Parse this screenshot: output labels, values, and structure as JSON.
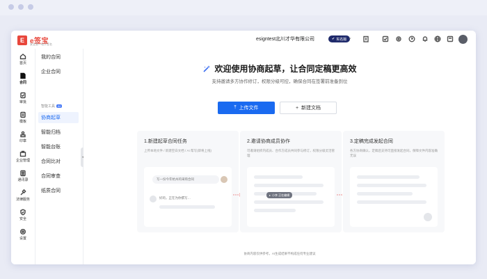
{
  "app": {
    "logo_text": "e签宝",
    "logo_subtitle": "安全第一电子签名"
  },
  "header": {
    "org_name": "esigntest北川才华有限公司",
    "org_badge": "实名版"
  },
  "leftrail": {
    "items": [
      {
        "label": "首页",
        "icon": "home-icon"
      },
      {
        "label": "合同",
        "icon": "contract-icon"
      },
      {
        "label": "审批",
        "icon": "approval-icon"
      },
      {
        "label": "模板",
        "icon": "template-icon"
      },
      {
        "label": "印章",
        "icon": "seal-icon"
      },
      {
        "label": "企业管理",
        "icon": "company-icon"
      },
      {
        "label": "通讯录",
        "icon": "contacts-icon"
      },
      {
        "label": "法律服务",
        "icon": "legal-icon"
      },
      {
        "label": "安全",
        "icon": "shield-icon"
      },
      {
        "label": "设置",
        "icon": "gear-icon"
      }
    ]
  },
  "subnav": {
    "items": [
      {
        "label": "我的合同"
      },
      {
        "label": "企业合同"
      }
    ],
    "group_label": "智能工具",
    "group_badge": "AI",
    "tools": [
      {
        "label": "协商起草",
        "active": true
      },
      {
        "label": "智能归档"
      },
      {
        "label": "智能台账"
      },
      {
        "label": "合同比对"
      },
      {
        "label": "合同审查"
      },
      {
        "label": "纸质合同"
      }
    ]
  },
  "main": {
    "title": "欢迎使用协商起草，让合同定稿更高效",
    "subtitle": "支持邀请多方协作修订，权限分级可控，确保合同在签署前准备到位",
    "upload_button": "上传文件",
    "new_button": "新建文档",
    "steps": [
      {
        "title": "1.新建起草合同任务",
        "desc": "上传本地文件 / 新建空白文档 / AI 帮写(即将上线)",
        "prompt_text": "写一份今年杭州的采购合同",
        "reply_text": "好的，正在为你撰写…"
      },
      {
        "title": "2.邀请协商成员协作",
        "desc": "可邀请组织内成员、合作方成员共同参与修订，权限分级灵活管理",
        "cursor_tag": "小李 正在编辑"
      },
      {
        "title": "3.定稿完成发起合同",
        "desc": "各方协商确认，定稿后支持可直接发起合同，保障文件内容准确无误"
      }
    ],
    "footer_note": "协商内容仅供参考，AI生成结果不构成任何专业建议"
  },
  "colors": {
    "primary": "#1a6af0",
    "brand": "#e8473c",
    "badge": "#1f2a6b"
  }
}
